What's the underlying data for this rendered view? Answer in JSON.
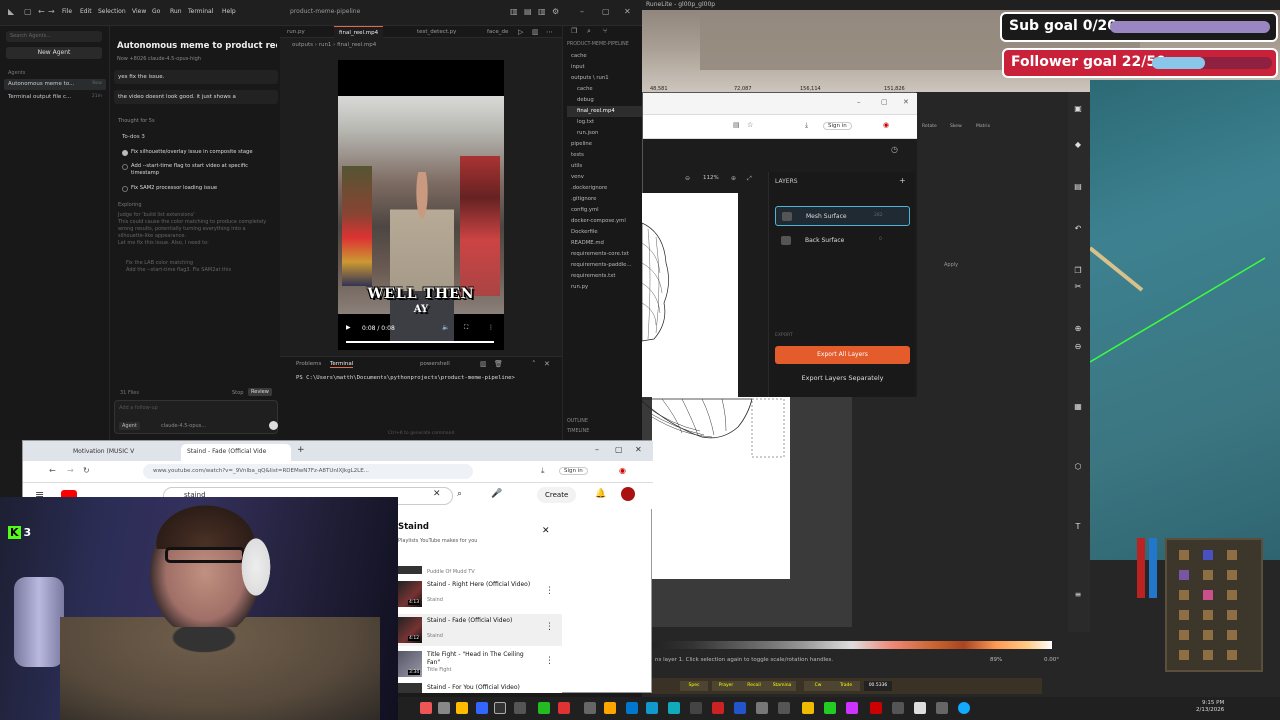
{
  "ide": {
    "menu": [
      "File",
      "Edit",
      "Selection",
      "View",
      "Go",
      "Run",
      "Terminal",
      "Help"
    ],
    "title": "product-meme-pipeline",
    "search_placeholder": "Search Agents...",
    "new_agent": "New Agent",
    "agents_label": "Agents",
    "agents": [
      {
        "label": "Autonomous meme to...",
        "time": "Now"
      },
      {
        "label": "Terminal output file c...",
        "time": "21m"
      }
    ],
    "chat_title": "Autonomous meme to product reel gene...",
    "chat_meta": "Now   +8026   claude-4.5-opus-high",
    "msg1": "yes fix the issue.",
    "msg2": "the video doesnt look good. it just shows a",
    "thought": "Thought for 5s",
    "todo_header": "To-dos  3",
    "todos": [
      {
        "text": "Fix silhouette/overlay issue in composite stage",
        "done": true
      },
      {
        "text": "Add --start-time flag to start video at specific timestamp",
        "done": false
      },
      {
        "text": "Fix SAM2 processor loading issue",
        "done": false
      }
    ],
    "exploring": "Exploring",
    "dim_lines": [
      "Judge for 'build list extensions'",
      "This could cause the color matching to produce completely",
      "wrong results, potentially turning everything into a",
      "silhouette-like appearance.",
      "Let me fix this issue. Also, I need to:"
    ],
    "dim_lines2": [
      "Fix the LAB color matching",
      "Add the --start-time flag3. Fix SAM2at this"
    ],
    "files_count": "31 Files",
    "stop": "Stop",
    "review": "Review",
    "followup": "Add a follow-up",
    "agent_mode": "Agent",
    "model": "claude-4.5-opus...",
    "tabs": [
      "run.py",
      "final_reel.mp4",
      "test_detect.py",
      "face_de"
    ],
    "breadcrumb": "outputs › run1 › final_reel.mp4",
    "video_caption1": "WELL THEN",
    "video_caption2": "AY",
    "video_time": "0:08 / 0:08",
    "explorer_header": "PRODUCT-MEME-PIPELINE",
    "files": [
      "cache",
      "input",
      "outputs \\ run1",
      "cache",
      "debug",
      "final_reel.mp4",
      "log.txt",
      "run.json",
      "pipeline",
      "tests",
      "utils",
      "venv",
      ".dockerignore",
      ".gitignore",
      "config.yml",
      "docker-compose.yml",
      "Dockerfile",
      "README.md",
      "requirements-core.txt",
      "requirements-paddle...",
      "requirements.txt",
      "run.py"
    ],
    "outline": "OUTLINE",
    "timeline": "TIMELINE",
    "term_tabs": [
      "Problems",
      "Terminal"
    ],
    "shell": "powershell",
    "prompt": "PS C:\\Users\\matth\\Documents\\pythonprojects\\product-meme-pipeline>",
    "hint": "Ctrl+K to generate command"
  },
  "game": {
    "title": "RuneLite - gl00p_gl00p",
    "stat1": "48,581",
    "stat2": "72,087",
    "stat3": "156,114",
    "stat4": "151,826",
    "subgoal": "Sub goal 0/20",
    "subgoal_progress": 0.0,
    "followergoal": "Follower goal 22/50",
    "followergoal_progress": 0.44
  },
  "tool3d": {
    "signin": "Sign in",
    "zoom": "112%",
    "layers_title": "LAYERS",
    "layers": [
      {
        "name": "Mesh Surface",
        "count": "282"
      },
      {
        "name": "Back Surface",
        "count": "0"
      }
    ],
    "export_label": "EXPORT",
    "export_all": "Export All Layers",
    "export_sep": "Export Layers Separately",
    "status": "ns layer 1. Click selection again to toggle scale/rotation handles.",
    "zoom_bottom": "89%",
    "angle": "0.00°",
    "apply": "Apply",
    "tabs": [
      "Rotate",
      "Skew",
      "Matrix"
    ]
  },
  "hud": [
    "Spec",
    "Prayer",
    "Recoil",
    "Stamina",
    "Cw",
    "Trade",
    "00.5336"
  ],
  "browser": {
    "tabs": [
      "Motivation (MUSIC V",
      "Staind - Fade (Official Vide"
    ],
    "url": "www.youtube.com/watch?v=_9Vnlba_qQ&list=RDEMwN7Fz-A8TUnIXJkgL2LE...",
    "signin": "Sign in",
    "search": "staind",
    "create": "Create",
    "playlist_title": "Staind",
    "playlist_sub": "Playlists YouTube makes for you",
    "playlist_prev": "Puddle Of Mudd TV",
    "items": [
      {
        "title": "Staind - Right Here (Official Video)",
        "channel": "Staind",
        "dur": "4:13"
      },
      {
        "title": "Staind - Fade (Official Video)",
        "channel": "Staind",
        "dur": "4:12"
      },
      {
        "title": "Title Fight - \"Head in The Ceiling Fan\"",
        "channel": "Title Fight",
        "dur": "3:34"
      },
      {
        "title": "Staind - For You (Official Video)",
        "channel": "Staind",
        "dur": ""
      }
    ],
    "prev_dur": "4:18"
  },
  "kick": {
    "logo": "K",
    "count": "3"
  },
  "clock": {
    "time": "9:15 PM",
    "date": "2/13/2026"
  }
}
